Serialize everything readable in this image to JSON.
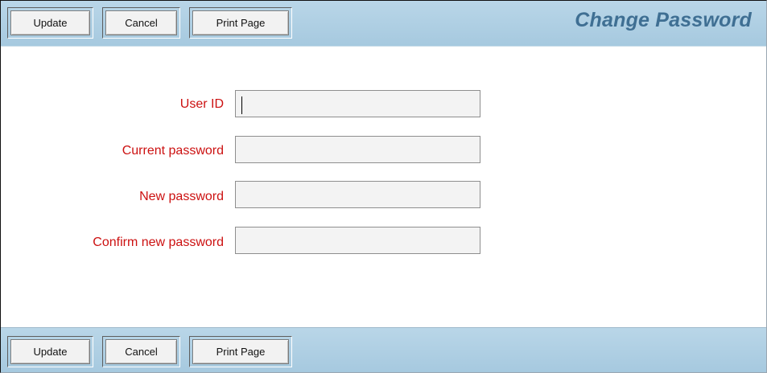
{
  "top_toolbar": {
    "update_label": "Update",
    "cancel_label": "Cancel",
    "print_label": "Print Page",
    "title": "Change Password"
  },
  "form": {
    "user_id": {
      "label": "User ID",
      "value": "",
      "placeholder": ""
    },
    "current_password": {
      "label": "Current password",
      "value": "",
      "placeholder": ""
    },
    "new_password": {
      "label": "New password",
      "value": "",
      "placeholder": ""
    },
    "confirm_password": {
      "label": "Confirm new password",
      "value": "",
      "placeholder": ""
    }
  },
  "bottom_toolbar": {
    "update_label": "Update",
    "cancel_label": "Cancel",
    "print_label": "Print Page"
  },
  "colors": {
    "toolbar_bg": "#b9d6e8",
    "title": "#3f6f93",
    "label": "#cc1111",
    "field_bg": "#f3f3f3"
  }
}
